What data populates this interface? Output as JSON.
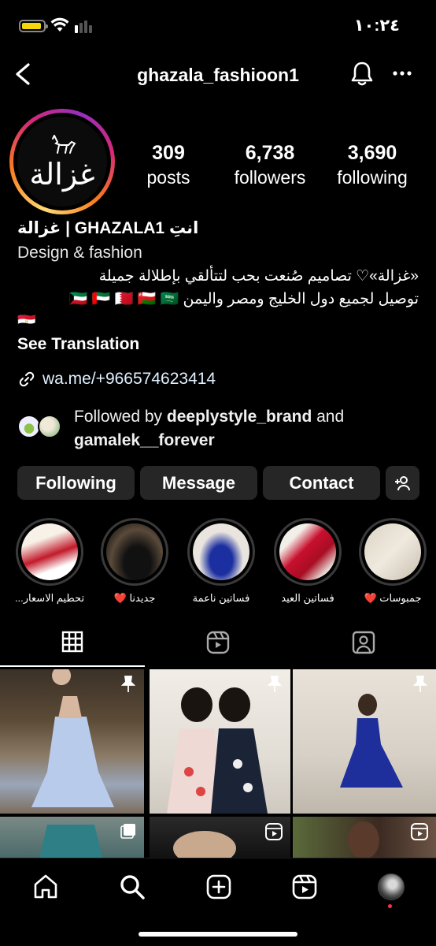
{
  "status_bar": {
    "time": "١٠:٢٤"
  },
  "header": {
    "username": "ghazala_fashioon1"
  },
  "profile": {
    "logo_text": "غزالة",
    "stats": [
      {
        "num": "309",
        "label": "posts"
      },
      {
        "num": "6,738",
        "label": "followers"
      },
      {
        "num": "3,690",
        "label": "following"
      }
    ],
    "display_name": "غزالة | GHAZALA1 انتِ",
    "category": "Design & fashion",
    "bio_line1": "«غزالة»♡ تصاميم صُنعت بحب لتتألقي بإطلالة جميلة",
    "bio_line2": "توصيل لجميع دول الخليج ومصر واليمن 🇰🇼 🇦🇪 🇧🇭 🇴🇲 🇸🇦",
    "bio_line3": "🇪🇬",
    "see_translation": "See Translation",
    "link": "wa.me/+966574623414",
    "followed_by_prefix": "Followed by ",
    "followed_by_user1": "deeplystyle_brand",
    "followed_by_and": " and",
    "followed_by_user2": "gamalek__forever"
  },
  "buttons": {
    "following": "Following",
    "message": "Message",
    "contact": "Contact"
  },
  "highlights": [
    {
      "label": "تحطيم الاسعار..."
    },
    {
      "label": "جديدنا ❤️"
    },
    {
      "label": "فساتين ناعمة"
    },
    {
      "label": "فساتين العيد"
    },
    {
      "label": "جمبوسات ❤️"
    }
  ],
  "colors": {
    "background": "#000000",
    "button_bg": "#262626",
    "ring_start": "#feda75",
    "ring_end": "#962fbf",
    "notification_dot": "#ff3040"
  },
  "icons": [
    "battery-icon",
    "wifi-icon",
    "signal-icon",
    "back-icon",
    "bell-icon",
    "more-icon",
    "link-icon",
    "add-person-icon",
    "grid-icon",
    "reels-icon",
    "tagged-icon",
    "pin-icon",
    "home-icon",
    "search-icon",
    "create-icon",
    "reels-nav-icon"
  ]
}
